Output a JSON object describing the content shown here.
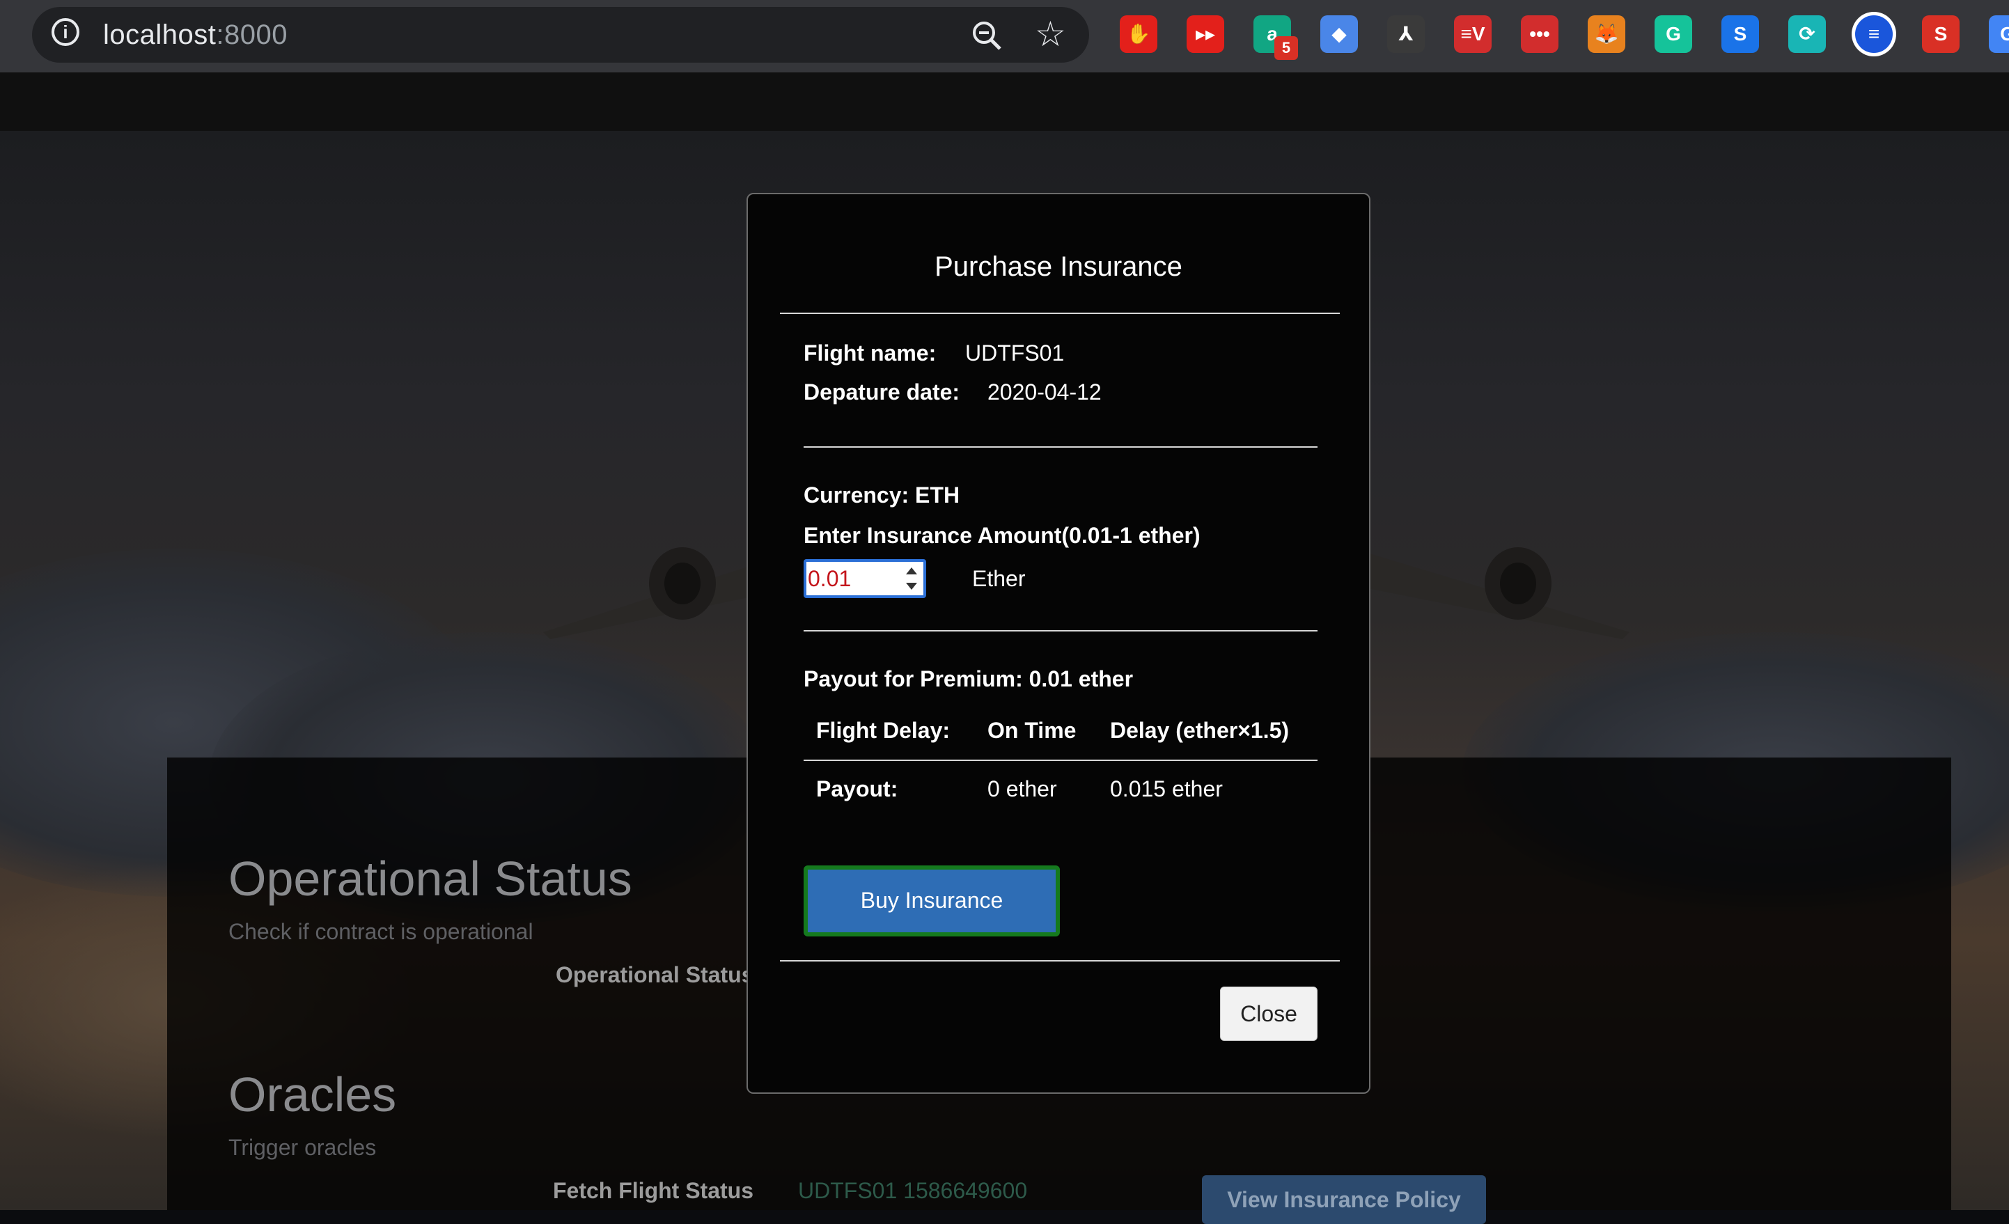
{
  "browser": {
    "url_host": "localhost",
    "url_port": ":8000",
    "extensions": [
      {
        "name": "adblock-icon",
        "color": "#e3201b",
        "glyph": "✋"
      },
      {
        "name": "youtube-icon",
        "color": "#e3201b",
        "glyph": "▸▸"
      },
      {
        "name": "grammar-icon",
        "color": "#11a683",
        "glyph": "a",
        "badge": "5"
      },
      {
        "name": "tag-icon",
        "color": "#4a86e8",
        "glyph": "◆"
      },
      {
        "name": "pdf-icon",
        "color": "#3a3a3a",
        "glyph": "⅄"
      },
      {
        "name": "vpn-icon",
        "color": "#d22d2d",
        "glyph": "≡V"
      },
      {
        "name": "more-icon",
        "color": "#d22d2d",
        "glyph": "•••"
      },
      {
        "name": "metamask-icon",
        "color": "#e8821e",
        "glyph": "🦊"
      },
      {
        "name": "grammarly-icon",
        "color": "#15c39a",
        "glyph": "G"
      },
      {
        "name": "skype-icon",
        "color": "#1a73e8",
        "glyph": "S"
      },
      {
        "name": "sync-icon",
        "color": "#19b5b5",
        "glyph": "⟳"
      },
      {
        "name": "profile-icon",
        "color": "#1a56db",
        "glyph": "≡"
      },
      {
        "name": "scribble-icon",
        "color": "#d93025",
        "glyph": "S"
      },
      {
        "name": "translate-icon",
        "color": "#4285f4",
        "glyph": "G"
      }
    ]
  },
  "background": {
    "operational_title": "Operational Status",
    "operational_subtitle": "Check if contract is operational",
    "operational_label": "Operational Status",
    "oracles_title": "Oracles",
    "oracles_subtitle": "Trigger oracles",
    "fetch_label": "Fetch Flight Status",
    "fetch_value": "UDTFS01 1586649600",
    "view_policy_button": "View Insurance Policy"
  },
  "modal": {
    "title": "Purchase Insurance",
    "flight_name_label": "Flight name:",
    "flight_name": "UDTFS01",
    "departure_label": "Depature date:",
    "departure_date": "2020-04-12",
    "currency_label": "Currency: ETH",
    "amount_label": "Enter Insurance Amount(0.01-1 ether)",
    "amount_value": "0.01",
    "amount_unit": "Ether",
    "payout_premium": "Payout for Premium: 0.01 ether",
    "table": {
      "headers": [
        "Flight Delay:",
        "On Time",
        "Delay (ether×1.5)"
      ],
      "row": [
        "Payout:",
        "0 ether",
        "0.015 ether"
      ]
    },
    "buy_button": "Buy Insurance",
    "close_button": "Close"
  },
  "colors": {
    "buy_button_bg": "#2e6db5",
    "buy_button_border": "#157a1e",
    "input_text": "#c4161c"
  }
}
